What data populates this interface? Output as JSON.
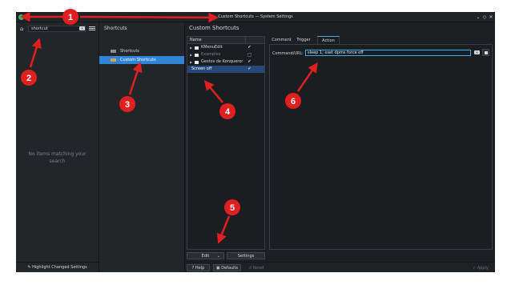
{
  "window": {
    "title": "Custom Shortcuts — System Settings",
    "controls": {
      "minimize": "⌄",
      "maximize": "◇",
      "close": "✕"
    }
  },
  "search_pane": {
    "home_icon": "home-icon",
    "search_value": "shortcut",
    "clear_icon": "clear-text-icon",
    "menu_icon": "hamburger-menu-icon",
    "empty_message": "No items matching your search",
    "highlight_button": "Highlight Changed Settings"
  },
  "category_pane": {
    "header": "Shortcuts",
    "items": [
      {
        "label": "Shortcuts",
        "selected": false
      },
      {
        "label": "Custom Shortcuts",
        "selected": true
      }
    ]
  },
  "main": {
    "title": "Custom Shortcuts",
    "tree": {
      "column_name": "Name",
      "rows": [
        {
          "label": "KMenuEdit",
          "expandable": true,
          "folder": true,
          "checked": true,
          "dim": false
        },
        {
          "label": "Examples",
          "expandable": true,
          "folder": true,
          "checked": false,
          "dim": true
        },
        {
          "label": "Gestos de Konqueror",
          "expandable": true,
          "folder": true,
          "checked": true,
          "dim": false
        },
        {
          "label": "Screen off",
          "expandable": false,
          "folder": false,
          "checked": true,
          "dim": false,
          "selected": true
        }
      ]
    },
    "edit_button": "Edit",
    "settings_button": "Settings",
    "tabs": [
      "Comment",
      "Trigger",
      "Action"
    ],
    "active_tab": "Action",
    "command_label": "Command/URL:",
    "command_value": "sleep 1; xset dpms force off"
  },
  "bottom": {
    "help": "Help",
    "defaults": "Defaults",
    "reset": "Reset",
    "apply": "Apply"
  },
  "annotations": [
    "1",
    "2",
    "3",
    "4",
    "5",
    "6"
  ],
  "colors": {
    "accent": "#2f86d6",
    "annotation": "#e02020",
    "window_bg": "#1e2124"
  }
}
